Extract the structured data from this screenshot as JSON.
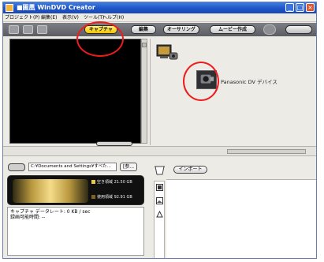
{
  "window": {
    "title": "WinDVD Creator",
    "title_prefix": "■圖凰"
  },
  "menu": {
    "items": [
      "プロジェクト(P)",
      "編集(E)",
      "表示(V)",
      "ツール(T)",
      "ヘルプ(H)"
    ]
  },
  "toolbar": {
    "tabs": [
      "キャプチャ",
      "編集",
      "オーサリング",
      "ムービー作成"
    ],
    "active_tab": "キャプチャ"
  },
  "device": {
    "name": "Panasonic DV デバイス"
  },
  "capture": {
    "folder_path": "C:¥Documents and Settings¥すべた...",
    "browse_label": "[参...",
    "free_space": "空き領域 21.50 GB",
    "used_space": "使用領域 92.91 GB",
    "data_rate": "キャプチャ データレート: 0 KB / sec",
    "recordable_time": "録画可能時間: --",
    "import_label": "インポート"
  },
  "colors": {
    "title_bar": "#2457c8",
    "active_tab": "#f3c400",
    "annotation": "#ee1c1c"
  }
}
